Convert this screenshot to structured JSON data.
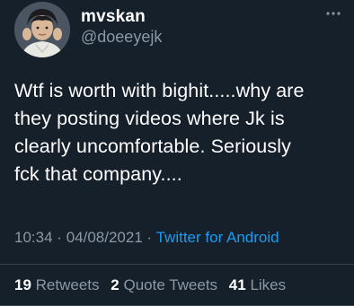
{
  "user": {
    "display_name": "mvskan",
    "handle": "@doeeyejk"
  },
  "tweet": {
    "lines": [
      "Wtf is worth with bighit.....why are",
      "they posting videos where Jk is",
      "clearly uncomfortable. Seriously",
      "fck that company...."
    ],
    "time": "10:34",
    "separator": "·",
    "date": "04/08/2021",
    "source": "Twitter for Android"
  },
  "stats": {
    "retweets_count": "19",
    "retweets_label": "Retweets",
    "quotes_count": "2",
    "quotes_label": "Quote Tweets",
    "likes_count": "41",
    "likes_label": "Likes"
  },
  "colors": {
    "background": "#15202b",
    "secondary_text": "#8b98a5",
    "link": "#1d9bf0",
    "divider": "#38444d"
  },
  "icons": {
    "more": "more-icon",
    "avatar": "avatar"
  }
}
